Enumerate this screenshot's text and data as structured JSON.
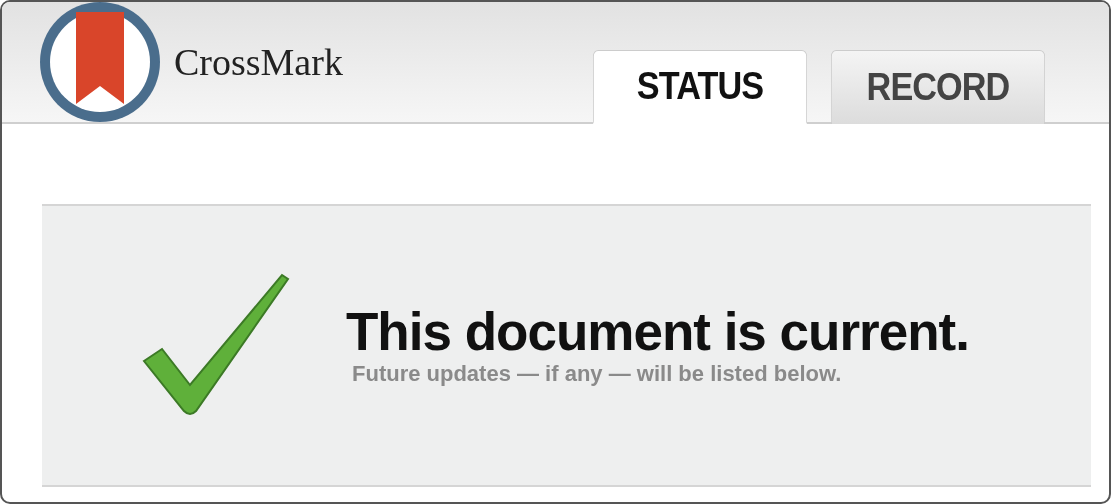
{
  "logo": {
    "text": "CrossMark"
  },
  "tabs": [
    {
      "label": "STATUS",
      "selected": true
    },
    {
      "label": "RECORD",
      "selected": false
    }
  ],
  "status": {
    "kind": "current",
    "title": "This document is current.",
    "subtitle": "Future updates — if any — will be listed below."
  }
}
